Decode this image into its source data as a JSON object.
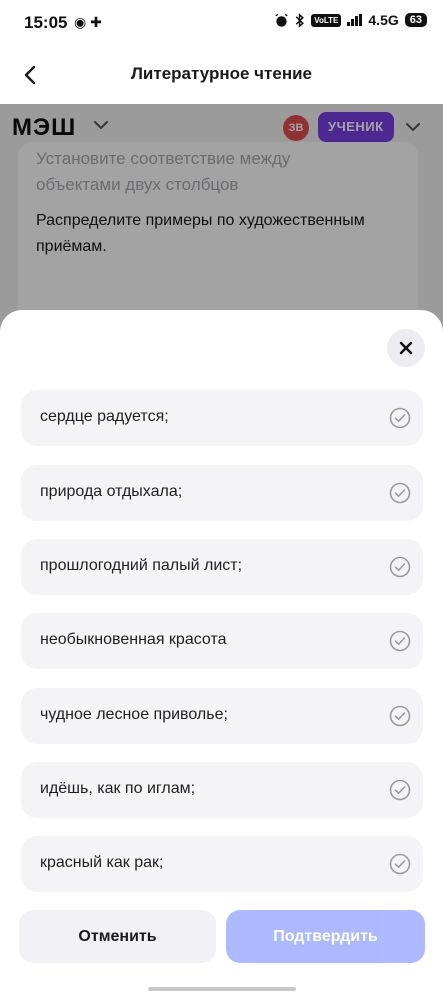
{
  "status_bar": {
    "time": "15:05",
    "left_icons": "◉ ✚",
    "volte": "VoLTE",
    "network": "4.5G",
    "battery": "63"
  },
  "app_header": {
    "title": "Литературное чтение",
    "back_icon": "chevron-left-icon"
  },
  "mesh_bar": {
    "logo": "МЭШ",
    "avatar_initials": "ЗВ",
    "role": "УЧЕНИК",
    "colors": {
      "avatar": "#e14b4b",
      "role_badge": "#7b3fe4"
    }
  },
  "task": {
    "hint": "Установите соответствие между объектами двух столбцов",
    "text": "Распределите примеры по художественным приёмам."
  },
  "sheet": {
    "close_icon": "close-icon",
    "options": [
      {
        "label": "сердце радуется;"
      },
      {
        "label": "природа отдыхала;"
      },
      {
        "label": "прошлогодний палый лист;"
      },
      {
        "label": "необыкновенная красота"
      },
      {
        "label": "чудное лесное приволье;"
      },
      {
        "label": "идёшь, как по иглам;"
      },
      {
        "label": "красный как рак;"
      }
    ],
    "option_icon": "check-circle-icon",
    "cancel_label": "Отменить",
    "confirm_label": "Подтвердить",
    "colors": {
      "confirm_bg": "#a9b6ff",
      "option_bg": "#f4f4f7"
    }
  }
}
